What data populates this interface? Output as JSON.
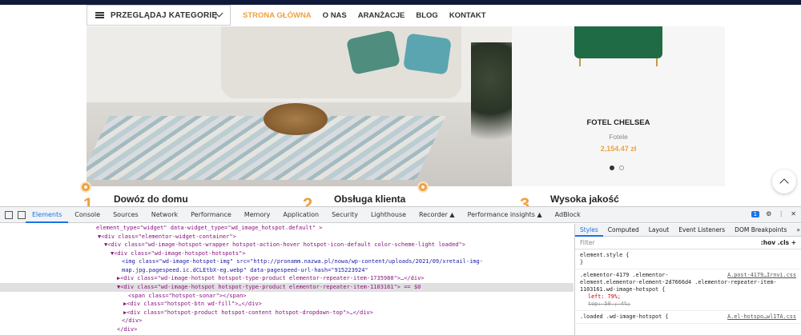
{
  "nav": {
    "categories_label": "PRZEGLĄDAJ KATEGORIĘ",
    "menu": [
      "STRONA GŁÓWNA",
      "O NAS",
      "ARANŻACJE",
      "BLOG",
      "KONTAKT"
    ],
    "accent": "#f0a03c"
  },
  "product": {
    "name": "FOTEL CHELSEA",
    "category": "Fotele",
    "price": "2,154.47 zł",
    "slides": 2,
    "active_slide": 1
  },
  "features": [
    {
      "num": "1",
      "title": "Dowóz do domu"
    },
    {
      "num": "2",
      "title": "Obsługa klienta"
    },
    {
      "num": "3",
      "title": "Wysoka jakość"
    }
  ],
  "devtools": {
    "tabs": [
      "Elements",
      "Console",
      "Sources",
      "Network",
      "Performance",
      "Memory",
      "Application",
      "Security",
      "Lighthouse",
      "Recorder ▲",
      "Performance insights ▲",
      "AdBlock"
    ],
    "active_tab": "Elements",
    "issues_count": "1",
    "styles_tabs": [
      "Styles",
      "Computed",
      "Layout",
      "Event Listeners",
      "DOM Breakpoints",
      "»"
    ],
    "filter_placeholder": "Filter",
    "filter_right": ":hov .cls +",
    "dom_lines": [
      "element_type=\"widget\" data-widget_type=\"wd_image_hotspot.default\" >",
      "▼<div class=\"elementor-widget-container\">",
      "▼<div class=\"wd-image-hotspot-wrapper hotspot-action-hover hotspot-icon-default color-scheme-light loaded\">",
      "▼<div class=\"wd-image-hotspot-hotspots\">",
      "<img class=\"wd-image-hotspot-img\" src=\"http://pronamm.nazwa.pl/nowa/wp-content/uploads/2021/09/xretail-img-map.jpg.pagespeed.ic.dCLEtbX-eg.webp\" data-pagespeed-url-hash=\"915223924\" onload=\"pagespeed.CriticalImages.checkImageForCriticality(this);\">",
      "▶<div class=\"wd-image-hotspot hotspot-type-product elementor-repeater-item-1735980\">…</div>",
      "▼<div class=\"wd-image-hotspot hotspot-type-product elementor-repeater-item-1103161\"> == $0",
      "<span class=\"hotspot-sonar\"></span>",
      "▶<div class=\"hotspot-btn wd-fill\">…</div>",
      "▶<div class=\"hotspot-product hotspot-content hotspot-dropdown-top\">…</div>",
      "</div>",
      "</div>"
    ],
    "css_rules": [
      {
        "selector": "element.style {",
        "body": "}",
        "source": ""
      },
      {
        "selector": ".elementor-4179 .elementor-element.elementor-element-2d7666d4 .elementor-repeater-item-1103161.wd-image-hotspot {",
        "body": "left: 79%;",
        "struck": "top: 50 ; 4%;",
        "source": "A.post-4179…Irnvi.css"
      },
      {
        "selector": ".loaded .wd-image-hotspot {",
        "body": "",
        "source": "A.el-hotspo…wl1TA.css"
      }
    ]
  }
}
